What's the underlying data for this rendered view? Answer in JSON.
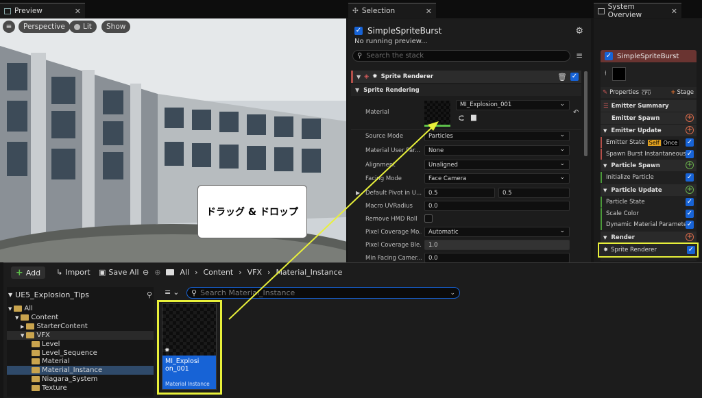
{
  "preview": {
    "tab_label": "Preview",
    "perspective": "Perspective",
    "lit": "Lit",
    "show": "Show",
    "annotation": "ドラッグ & ドロップ"
  },
  "selection": {
    "tab_label": "Selection",
    "system_name": "SimpleSpriteBurst",
    "status": "No running preview...",
    "search_placeholder": "Search the stack",
    "section": "Sprite Renderer",
    "subsection": "Sprite Rendering",
    "material_label": "Material",
    "material_value": "MI_Explosion_001",
    "rows": [
      {
        "label": "Source Mode",
        "value": "Particles"
      },
      {
        "label": "Material User Par...",
        "value": "None"
      },
      {
        "label": "Alignment",
        "value": "Unaligned"
      },
      {
        "label": "Facing Mode",
        "value": "Face Camera"
      },
      {
        "label": "Default Pivot in U...",
        "value": "0.5",
        "value2": "0.5"
      },
      {
        "label": "Macro UVRadius",
        "value": "0.0"
      },
      {
        "label": "Remove HMD Roll",
        "value": ""
      },
      {
        "label": "Pixel Coverage Mo...",
        "value": "Automatic"
      },
      {
        "label": "Pixel Coverage Ble...",
        "value": "1.0"
      },
      {
        "label": "Min Facing Camer...",
        "value": "0.0"
      }
    ]
  },
  "overview": {
    "tab_label": "System Overview",
    "emitter_name": "SimpleSpriteBurst",
    "properties": "Properties",
    "cpu": "CPU",
    "stage": "Stage",
    "items": {
      "emitter_summary": "Emitter Summary",
      "emitter_spawn": "Emitter Spawn",
      "emitter_update": "Emitter Update",
      "emitter_state": "Emitter State",
      "self": "Self",
      "once": "Once",
      "spawn_burst": "Spawn Burst Instantaneous",
      "particle_spawn": "Particle Spawn",
      "initialize_particle": "Initialize Particle",
      "particle_update": "Particle Update",
      "particle_state": "Particle State",
      "scale_color": "Scale Color",
      "dynamic_material": "Dynamic Material Parameters",
      "render": "Render",
      "sprite_renderer": "Sprite Renderer"
    }
  },
  "browser": {
    "add": "Add",
    "import": "Import",
    "save_all": "Save All",
    "breadcrumb": [
      "All",
      "Content",
      "VFX",
      "Material_Instance"
    ],
    "project": "UE5_Explosion_Tips",
    "search_placeholder": "Search Material_Instance",
    "tree": [
      "All",
      "Content",
      "StarterContent",
      "VFX",
      "Level",
      "Level_Sequence",
      "Material",
      "Material_Instance",
      "Niagara_System",
      "Texture"
    ],
    "asset_name": "MI_Explosion_001",
    "asset_type": "Material Instance"
  },
  "colors": {
    "accent": "#1763d6",
    "highlight": "#e8f03a"
  }
}
